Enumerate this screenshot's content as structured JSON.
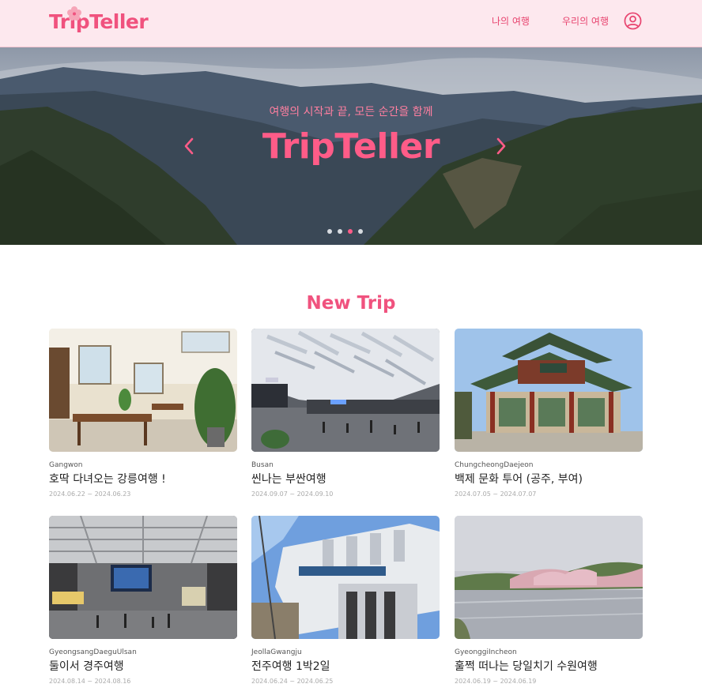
{
  "header": {
    "logo": "TripTeller",
    "nav": {
      "my_trip": "나의 여행",
      "our_trip": "우리의 여행"
    },
    "profile_icon": "user-circle-icon",
    "brand_color": "#f0527e"
  },
  "hero": {
    "subtitle": "여행의 시작과 끝, 모든 순간을 함께",
    "title": "TripTeller",
    "slide_count": 4,
    "active_slide": 3
  },
  "section": {
    "title": "New Trip",
    "cards": [
      {
        "region": "Gangwon",
        "title": "호딱 다녀오는 강릉여행 !",
        "dates": "2024.06.22 ~ 2024.06.23"
      },
      {
        "region": "Busan",
        "title": "씬나는 부싼여행",
        "dates": "2024.09.07 ~ 2024.09.10"
      },
      {
        "region": "ChungcheongDaejeon",
        "title": "백제 문화 투어 (공주, 부여)",
        "dates": "2024.07.05 ~ 2024.07.07"
      },
      {
        "region": "GyeongsangDaeguUlsan",
        "title": "둘이서 경주여행",
        "dates": "2024.08.14 ~ 2024.08.16"
      },
      {
        "region": "JeollaGwangju",
        "title": "전주여행 1박2일",
        "dates": "2024.06.24 ~ 2024.06.25"
      },
      {
        "region": "GyeonggiIncheon",
        "title": "훌쩍 떠나는 당일치기 수원여행",
        "dates": "2024.06.19 ~ 2024.06.19"
      }
    ]
  }
}
